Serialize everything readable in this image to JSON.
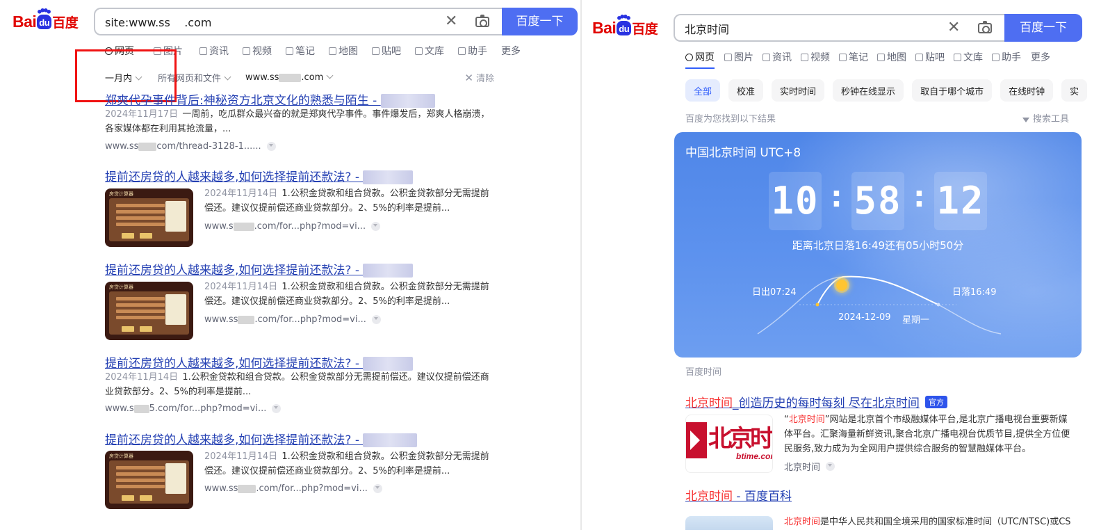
{
  "left": {
    "logo": {
      "bai": "Bai",
      "du": "du",
      "cn": "百度"
    },
    "search": {
      "value": "site:www.ss  .com",
      "button": "百度一下"
    },
    "tabs": [
      {
        "label": "网页",
        "icon": "search-icon"
      },
      {
        "label": "图片",
        "icon": "image-icon"
      },
      {
        "label": "资讯",
        "icon": "news-icon"
      },
      {
        "label": "视频",
        "icon": "video-icon"
      },
      {
        "label": "笔记",
        "icon": "note-icon"
      },
      {
        "label": "地图",
        "icon": "map-icon"
      },
      {
        "label": "贴吧",
        "icon": "tieba-icon"
      },
      {
        "label": "文库",
        "icon": "wenku-icon"
      },
      {
        "label": "助手",
        "icon": "ai-icon"
      },
      {
        "label": "更多"
      }
    ],
    "filters": {
      "time": "一月内",
      "type": "所有网页和文件",
      "site": "www.ss",
      "site_tld": ".com",
      "clear": "清除"
    },
    "results": [
      {
        "title": "郑爽代孕事件背后:神秘资方北京文化的熟悉与陌生 - ",
        "date": "2024年11月17日",
        "desc": "一周前，吃瓜群众最兴奋的就是郑爽代孕事件。事件爆发后，郑爽人格崩溃，各家媒体都在利用其抢流量，...",
        "url_a": "www.ss",
        "url_b": "com/thread-3128-1......"
      },
      {
        "title": "提前还房贷的人越来越多,如何选择提前还款法? - ",
        "date": "2024年11月14日",
        "desc": "1.公积金贷款和组合贷款。公积金贷款部分无需提前偿还。建议仅提前偿还商业贷款部分。2、5%的利率是提前...",
        "url_a": "www.s",
        "url_b": ".com/for...php?mod=vi..."
      },
      {
        "title": "提前还房贷的人越来越多,如何选择提前还款法? - ",
        "date": "2024年11月14日",
        "desc": "1.公积金贷款和组合贷款。公积金贷款部分无需提前偿还。建议仅提前偿还商业贷款部分。2、5%的利率是提前...",
        "url_a": "www.ss",
        "url_b": ".com/for...php?mod=vi..."
      },
      {
        "title": "提前还房贷的人越来越多,如何选择提前还款法? - ",
        "date": "2024年11月14日",
        "desc": "1.公积金贷款和组合贷款。公积金贷款部分无需提前偿还。建议仅提前偿还商业贷款部分。2、5%的利率是提前...",
        "url_a": "www.s",
        "url_b": "5.com/for...php?mod=vi..."
      },
      {
        "title": "提前还房贷的人越来越多,如何选择提前还款法? - ",
        "date": "2024年11月14日",
        "desc": "1.公积金贷款和组合贷款。公积金贷款部分无需提前偿还。建议仅提前偿还商业贷款部分。2、5%的利率是提前...",
        "url_a": "www.ss",
        "url_b": ".com/for...php?mod=vi..."
      }
    ],
    "thumb_header": "房贷计算器"
  },
  "right": {
    "logo": {
      "bai": "Bai",
      "du": "du",
      "cn": "百度"
    },
    "search": {
      "value": "北京时间",
      "button": "百度一下"
    },
    "tabs": [
      {
        "label": "网页",
        "icon": "search-icon"
      },
      {
        "label": "图片",
        "icon": "image-icon"
      },
      {
        "label": "资讯",
        "icon": "news-icon"
      },
      {
        "label": "视频",
        "icon": "video-icon"
      },
      {
        "label": "笔记",
        "icon": "note-icon"
      },
      {
        "label": "地图",
        "icon": "map-icon"
      },
      {
        "label": "贴吧",
        "icon": "tieba-icon"
      },
      {
        "label": "文库",
        "icon": "wenku-icon"
      },
      {
        "label": "助手",
        "icon": "ai-icon"
      },
      {
        "label": "更多"
      }
    ],
    "chips": [
      "全部",
      "校准",
      "实时时间",
      "秒钟在线显示",
      "取自于哪个城市",
      "在线时钟",
      "实"
    ],
    "found_text": "百度为您找到以下结果",
    "tools": "搜索工具",
    "clock": {
      "title": "中国北京时间 UTC+8",
      "hh": "10",
      "mm": "58",
      "ss": "12",
      "sep": ":",
      "sunset_text": "距离北京日落16:49还有05小时50分",
      "sunrise": "日出07:24",
      "sunset": "日落16:49",
      "date": "2024-12-09",
      "weekday": "星期一"
    },
    "clock_source": "百度时间",
    "result1": {
      "title_red": "北京时间",
      "title_rest": "_创造历史的每时每刻 尽在北京时间",
      "badge": "官方",
      "desc_q1": "“",
      "desc_red": "北京时间",
      "desc_q2": "”",
      "desc": "网站是北京首个市级融媒体平台,是北京广播电视台重要新媒体平台。汇聚海量新鲜资讯,聚合北京广播电视台优质节目,提供全方位便民服务,致力成为为全网用户提供综合服务的智慧融媒体平台。",
      "source": "北京时间",
      "logo_cn": "北京时间",
      "logo_en": "btime.com"
    },
    "result2": {
      "title_red": "北京时间",
      "title_rest": " - 百度百科",
      "desc_red": "北京时间",
      "desc": "是中华人民共和国全境采用的国家标准时间（UTC/NTSC)或CS"
    }
  }
}
